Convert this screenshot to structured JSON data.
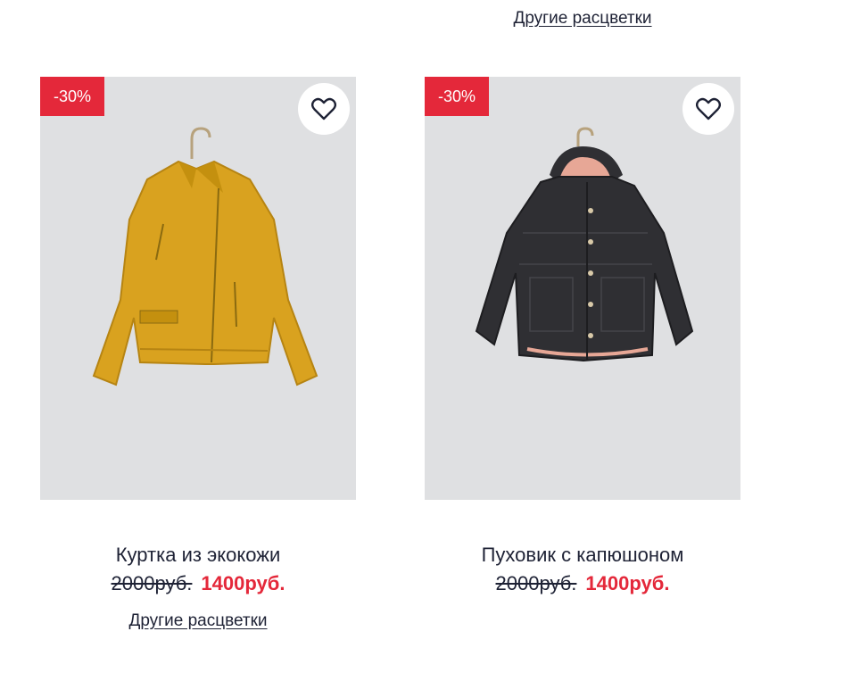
{
  "top_link": "Другие расцветки",
  "products": [
    {
      "badge": "-30%",
      "favorite_icon": "heart-icon",
      "image": "yellow-leather-jacket",
      "title": "Куртка из экокожи",
      "old_price": "2000руб.",
      "new_price": "1400руб.",
      "colors_link": "Другие расцветки"
    },
    {
      "badge": "-30%",
      "favorite_icon": "heart-icon",
      "image": "dark-hooded-parka",
      "title": "Пуховик с капюшоном",
      "old_price": "2000руб.",
      "new_price": "1400руб."
    }
  ],
  "colors": {
    "sale_red": "#e4283a",
    "text_dark": "#1e2235",
    "image_bg": "#dfe0e2",
    "jacket_yellow": "#d9a21f",
    "parka_dark": "#2f2f33"
  }
}
